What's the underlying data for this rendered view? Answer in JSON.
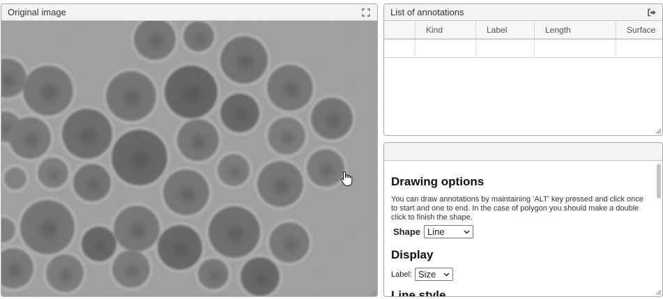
{
  "image_panel": {
    "title": "Original image",
    "fullscreen_icon": "fullscreen-icon"
  },
  "annotations_panel": {
    "title": "List of annotations",
    "export_icon": "sign-out-icon",
    "columns": [
      "Kind",
      "Label",
      "Length",
      "Surface",
      "..."
    ]
  },
  "options_panel": {
    "drawing_title": "Drawing options",
    "drawing_help": "You can draw annotations by maintaining 'ALT' key pressed and click once to start and one to end. In the case of polygon you should make a double click to finish the shape.",
    "shape_label": "Shape",
    "shape_value": "Line",
    "display_title": "Display",
    "label_label": "Label:",
    "label_value": "Size",
    "next_heading": "Line style"
  }
}
